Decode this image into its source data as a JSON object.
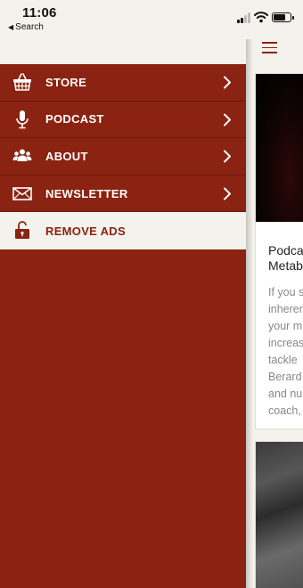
{
  "status_bar": {
    "time": "11:06",
    "back_label": "Search",
    "back_glyph": "◀"
  },
  "drawer": {
    "items": [
      {
        "label": "STORE",
        "icon": "basket-icon"
      },
      {
        "label": "PODCAST",
        "icon": "microphone-icon"
      },
      {
        "label": "ABOUT",
        "icon": "people-icon"
      },
      {
        "label": "NEWSLETTER",
        "icon": "envelope-icon"
      },
      {
        "label": "REMOVE ADS",
        "icon": "lock-icon"
      }
    ]
  },
  "content": {
    "card": {
      "title_line1": "Podca",
      "title_line2": "Metab",
      "body_lines": [
        "If you s",
        "inherer",
        "your m",
        "increas",
        "tackle",
        "Berard",
        "and nu",
        "coach,"
      ]
    }
  },
  "colors": {
    "accent": "#8a2311",
    "background_light": "#f4f2ec"
  }
}
